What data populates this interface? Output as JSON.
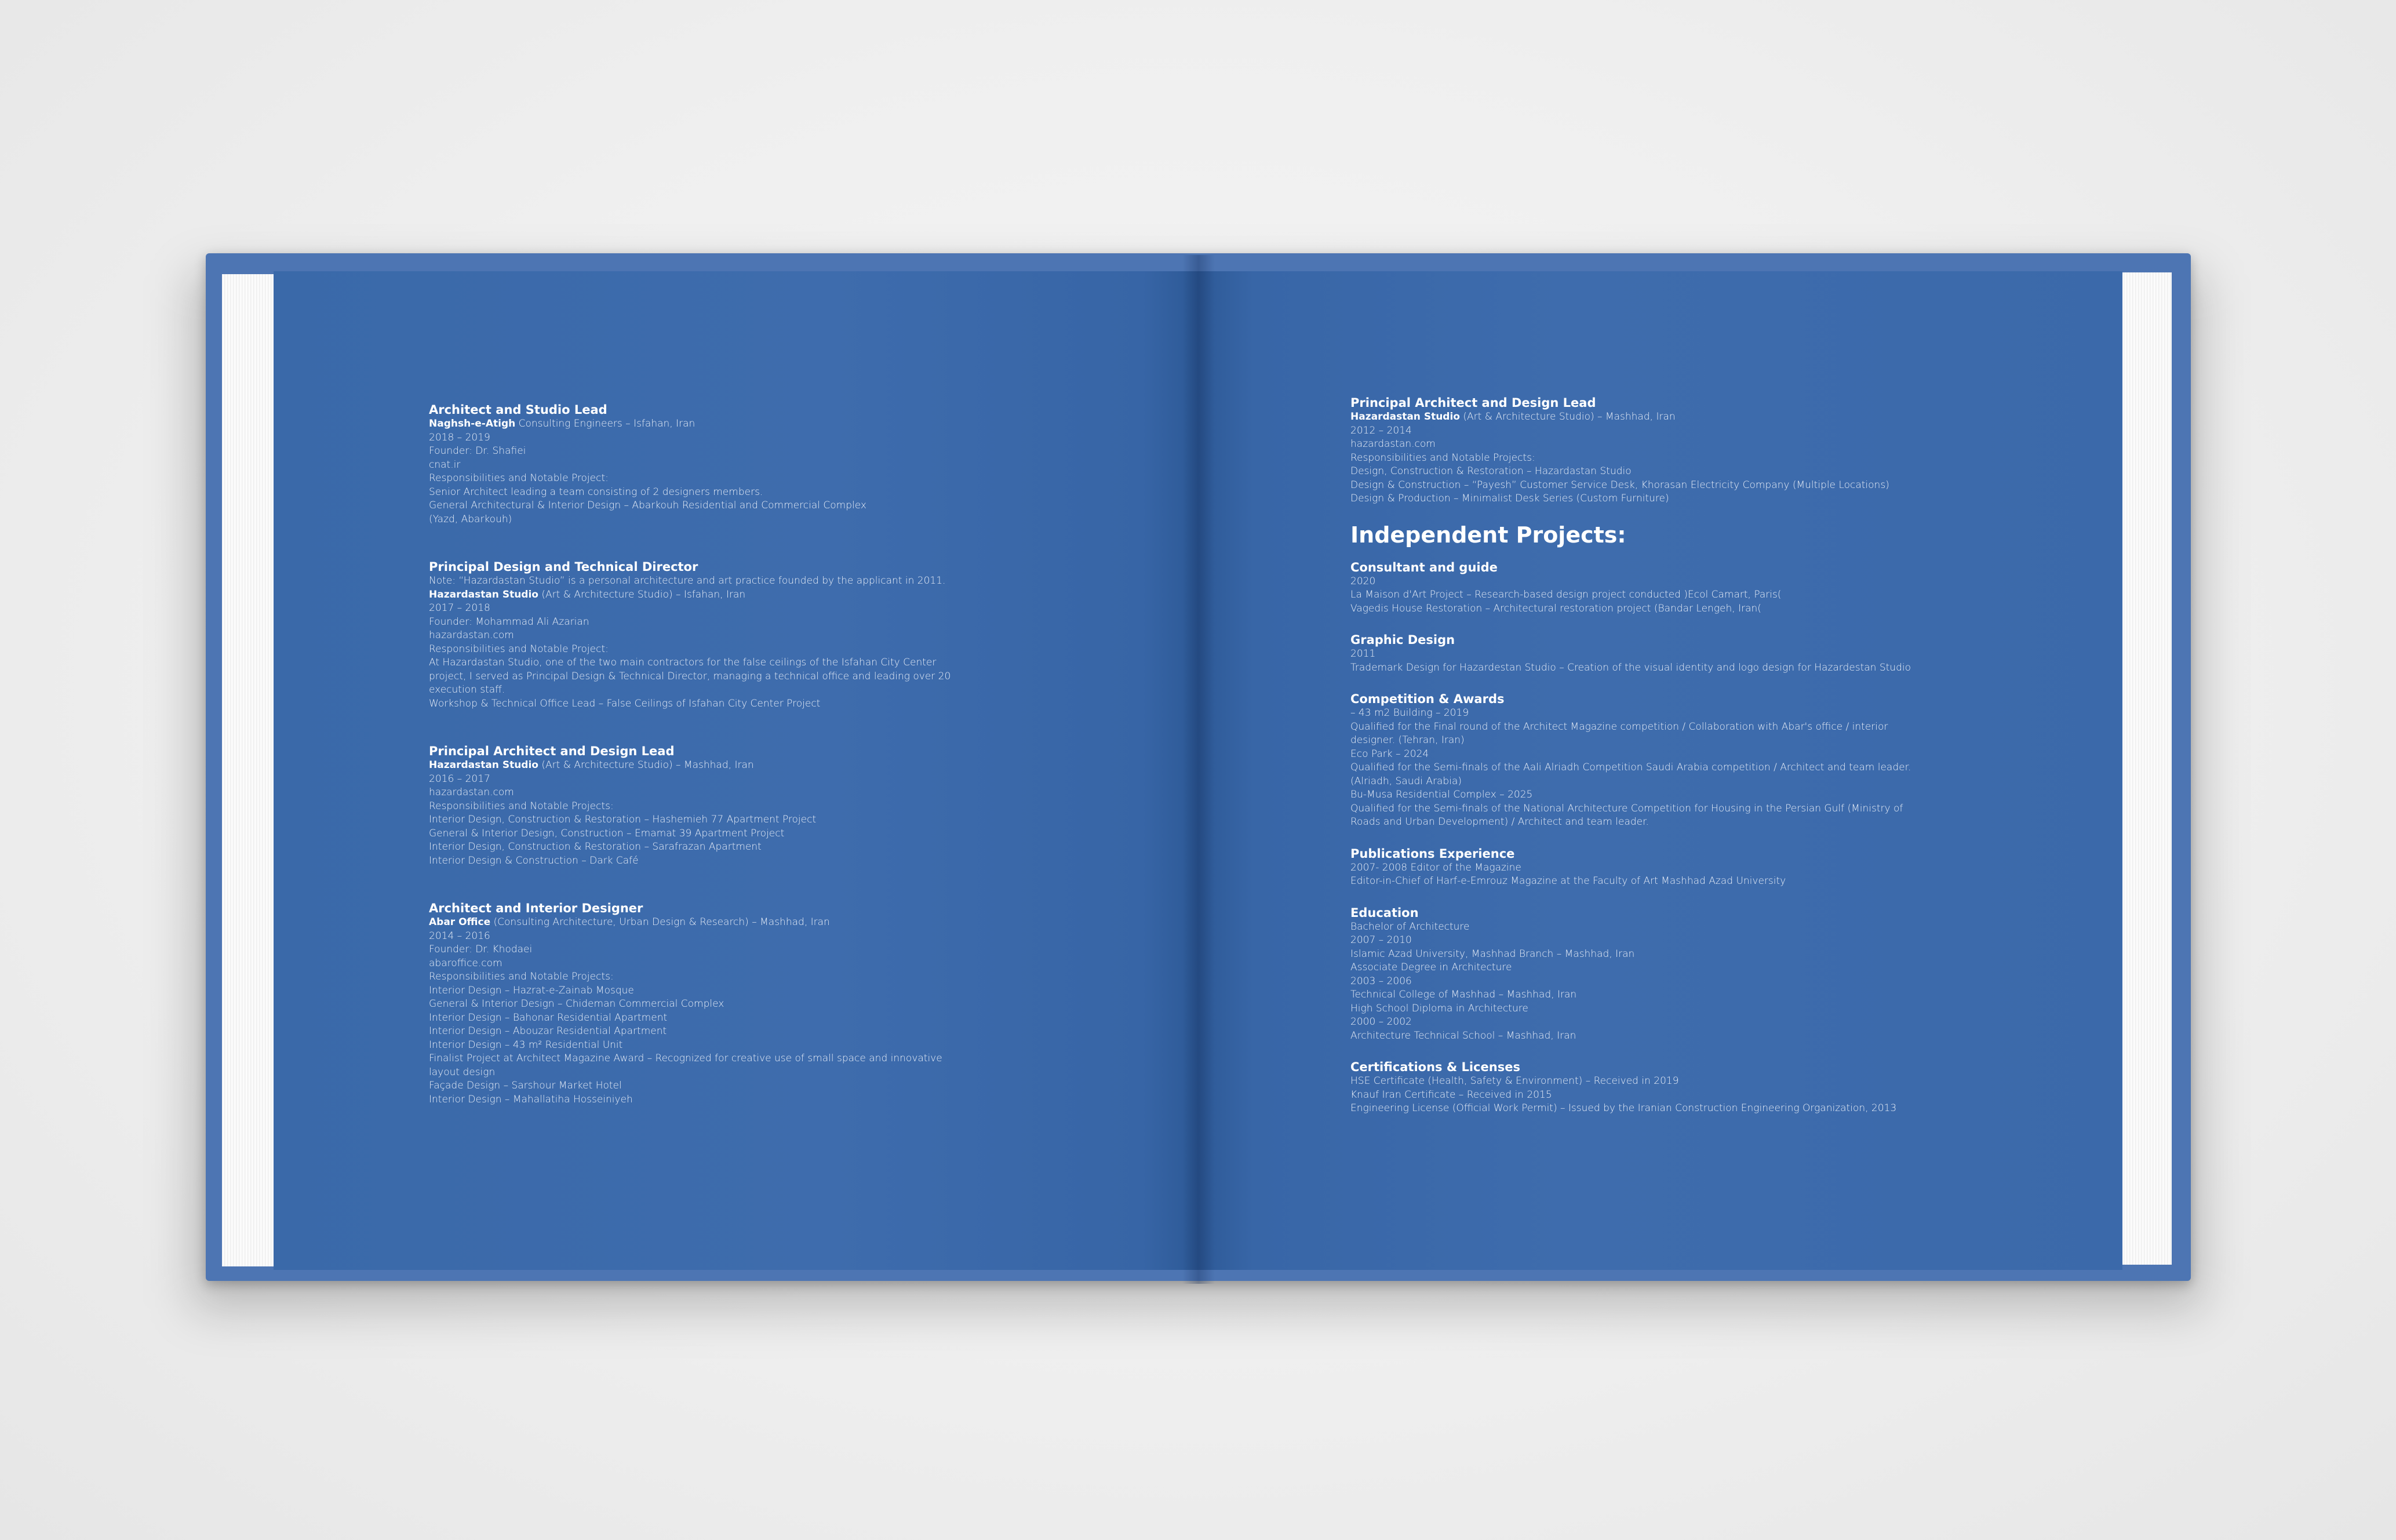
{
  "left_page": {
    "entries": [
      {
        "title": "Architect and Studio Lead",
        "company_bold": "Naghsh-e-Atigh",
        "company_rest": " Consulting Engineers – Isfahan, Iran",
        "lines": [
          "2018 – 2019",
          "Founder: Dr. Shafiei",
          "cnat.ir",
          "Responsibilities and Notable Project:",
          "Senior Architect leading a team consisting of 2 designers members.",
          "General Architectural & Interior Design – Abarkouh Residential and Commercial Complex",
          "(Yazd, Abarkouh)"
        ]
      },
      {
        "title": "Principal Design and Technical Director",
        "note": "Note: “Hazardastan Studio” is a personal architecture and art practice founded by the applicant in 2011.",
        "company_bold": "Hazardastan Studio",
        "company_rest": " (Art & Architecture Studio) – Isfahan, Iran",
        "lines": [
          "2017 – 2018",
          "Founder: Mohammad Ali Azarian",
          "hazardastan.com",
          "Responsibilities and Notable Project:",
          "At Hazardastan Studio, one of the two main contractors for the false ceilings of the Isfahan City Center project, I served as Principal Design & Technical Director, managing a technical office and leading over 20 execution staff.",
          "Workshop & Technical Office Lead – False Ceilings of Isfahan City Center Project"
        ]
      },
      {
        "title": "Principal Architect and Design Lead",
        "company_bold": "Hazardastan Studio",
        "company_rest": " (Art & Architecture Studio) – Mashhad, Iran",
        "lines": [
          "2016 – 2017",
          "hazardastan.com",
          "Responsibilities and Notable Projects:",
          "Interior Design, Construction & Restoration – Hashemieh 77 Apartment Project",
          "General & Interior Design, Construction – Emamat 39 Apartment Project",
          "Interior Design, Construction & Restoration – Sarafrazan Apartment",
          "Interior Design & Construction – Dark Café"
        ]
      },
      {
        "title": "Architect and Interior Designer",
        "company_bold": "Abar Office",
        "company_rest": " (Consulting Architecture, Urban Design & Research) – Mashhad, Iran",
        "lines": [
          "2014 – 2016",
          "Founder: Dr. Khodaei",
          "abaroffice.com",
          "Responsibilities and Notable Projects:",
          "Interior Design – Hazrat-e-Zainab Mosque",
          "General & Interior Design – Chideman Commercial Complex",
          "Interior Design – Bahonar Residential Apartment",
          "Interior Design – Abouzar Residential Apartment",
          "Interior Design – 43 m² Residential Unit",
          "Finalist Project at Architect Magazine Award – Recognized for creative use of small space and innovative layout design",
          "Façade Design – Sarshour Market Hotel",
          "Interior Design – Mahallatiha Hosseiniyeh"
        ]
      }
    ]
  },
  "right_page": {
    "top_entry": {
      "title": "Principal Architect and Design Lead",
      "company_bold": "Hazardastan Studio",
      "company_rest": " (Art & Architecture Studio) – Mashhad, Iran",
      "lines": [
        "2012 – 2014",
        "hazardastan.com",
        "Responsibilities and Notable Projects:",
        "Design, Construction & Restoration – Hazardastan Studio",
        "Design & Construction – “Payesh” Customer Service Desk, Khorasan Electricity Company (Multiple Locations)",
        "Design & Production – Minimalist Desk Series (Custom Furniture)"
      ]
    },
    "heading": "Independent Projects:",
    "sections": [
      {
        "title": "Consultant and guide",
        "lines": [
          "2020",
          "La Maison d'Art Project – Research-based design project conducted )Ecol Camart, Paris(",
          "Vagedis House Restoration – Architectural restoration project (Bandar Lengeh, Iran("
        ]
      },
      {
        "title": "Graphic Design",
        "lines": [
          "2011",
          "Trademark Design for Hazardestan Studio – Creation of the visual identity and logo design for Hazardestan Studio"
        ]
      },
      {
        "title": "Competition & Awards",
        "lines": [
          "– 43 m2 Building – 2019",
          "Qualified for the Final round of the Architect Magazine competition / Collaboration with Abar's office / interior designer. (Tehran, Iran)",
          "Eco Park – 2024",
          "Qualified for the Semi-finals of the Aali Alriadh Competition Saudi Arabia competition / Architect and team leader. (Alriadh, Saudi Arabia)",
          "Bu-Musa Residential Complex – 2025",
          "Qualified for the Semi-finals of the National Architecture Competition for Housing in the Persian Gulf (Ministry of Roads and Urban Development) / Architect and team leader."
        ]
      },
      {
        "title": "Publications Experience",
        "lines": [
          "2007- 2008   Editor of the Magazine",
          "Editor-in-Chief of Harf-e-Emrouz Magazine at the Faculty of Art Mashhad Azad University"
        ]
      },
      {
        "title": "Education",
        "lines": [
          "Bachelor of Architecture",
          "2007 – 2010",
          "Islamic Azad University, Mashhad Branch – Mashhad, Iran",
          "Associate Degree in Architecture",
          "2003 – 2006",
          "Technical College of Mashhad – Mashhad, Iran",
          "High School Diploma in Architecture",
          "2000 – 2002",
          "Architecture Technical School – Mashhad, Iran"
        ]
      },
      {
        "title": "Certifications & Licenses",
        "lines": [
          "HSE Certificate (Health, Safety & Environment) – Received in 2019",
          "Knauf Iran Certificate – Received in 2015",
          "Engineering License (Official Work Permit) – Issued by the Iranian Construction Engineering Organization, 2013"
        ]
      }
    ]
  }
}
